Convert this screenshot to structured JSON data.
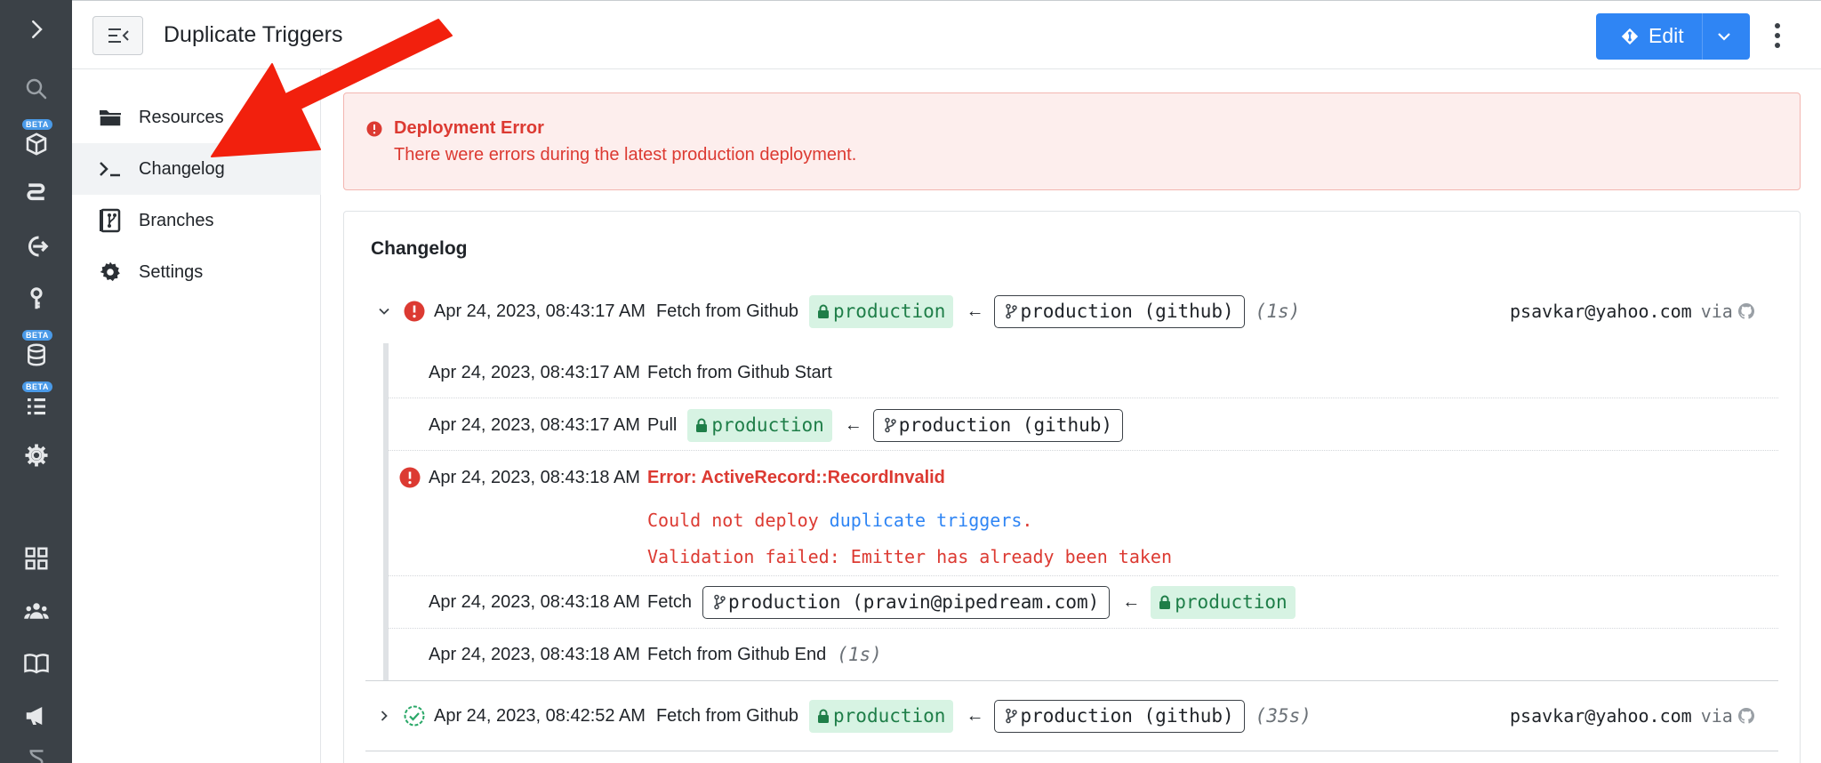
{
  "header": {
    "title": "Duplicate Triggers",
    "edit_label": "Edit"
  },
  "rail": {
    "beta_label": "BETA"
  },
  "sidenav": {
    "items": [
      {
        "label": "Resources"
      },
      {
        "label": "Changelog"
      },
      {
        "label": "Branches"
      },
      {
        "label": "Settings"
      }
    ]
  },
  "alert": {
    "title": "Deployment Error",
    "message": "There were errors during the latest production deployment."
  },
  "changelog": {
    "title": "Changelog",
    "entries": [
      {
        "timestamp": "Apr 24, 2023, 08:43:17 AM",
        "action": "Fetch from Github",
        "target": "production",
        "source": "production (github)",
        "duration": "(1s)",
        "user": "psavkar@yahoo.com",
        "via": "via",
        "status": "error"
      },
      {
        "timestamp": "Apr 24, 2023, 08:42:52 AM",
        "action": "Fetch from Github",
        "target": "production",
        "source": "production (github)",
        "duration": "(35s)",
        "user": "psavkar@yahoo.com",
        "via": "via",
        "status": "success"
      }
    ],
    "sub_entries": [
      {
        "timestamp": "Apr 24, 2023, 08:43:17 AM",
        "action": "Fetch from Github Start"
      },
      {
        "timestamp": "Apr 24, 2023, 08:43:17 AM",
        "action": "Pull",
        "target": "production",
        "source": "production (github)"
      },
      {
        "timestamp": "Apr 24, 2023, 08:43:18 AM",
        "error_title": "Error: ActiveRecord::RecordInvalid",
        "error_line1_prefix": "Could not deploy ",
        "error_line1_link": "duplicate triggers",
        "error_line1_suffix": ".",
        "error_line2": "Validation failed: Emitter has already been taken"
      },
      {
        "timestamp": "Apr 24, 2023, 08:43:18 AM",
        "action": "Fetch",
        "source": "production (pravin@pipedream.com)",
        "target": "production"
      },
      {
        "timestamp": "Apr 24, 2023, 08:43:18 AM",
        "action": "Fetch from Github End",
        "duration": "(1s)"
      }
    ]
  },
  "colors": {
    "rail_bg": "#3b4147",
    "accent": "#2f85f4",
    "error": "#dc3a32",
    "success": "#1e7e48",
    "annotation_arrow": "#f2200d"
  }
}
